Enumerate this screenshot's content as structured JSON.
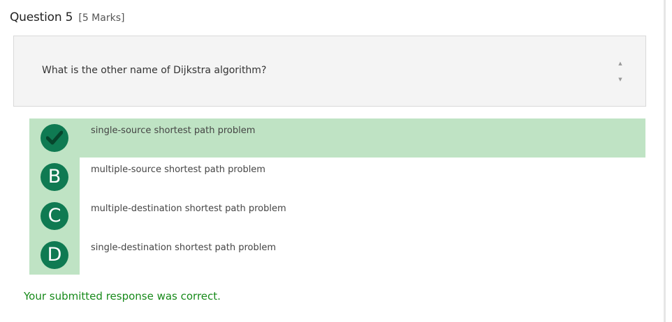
{
  "question": {
    "title": "Question 5",
    "marks": "[5 Marks]",
    "text": "What is the other name of Dijkstra algorithm?"
  },
  "options": [
    {
      "letter": "",
      "icon": "check-icon",
      "text": "single-source shortest path problem",
      "selected": true
    },
    {
      "letter": "B",
      "text": "multiple-source shortest path problem",
      "selected": false
    },
    {
      "letter": "C",
      "text": "multiple-destination shortest path problem",
      "selected": false
    },
    {
      "letter": "D",
      "text": "single-destination shortest path problem",
      "selected": false
    }
  ],
  "feedback": "Your submitted response was correct.",
  "colors": {
    "badge": "#0f7a52",
    "selected_background": "#bfe3c4",
    "feedback": "#178a1a"
  }
}
